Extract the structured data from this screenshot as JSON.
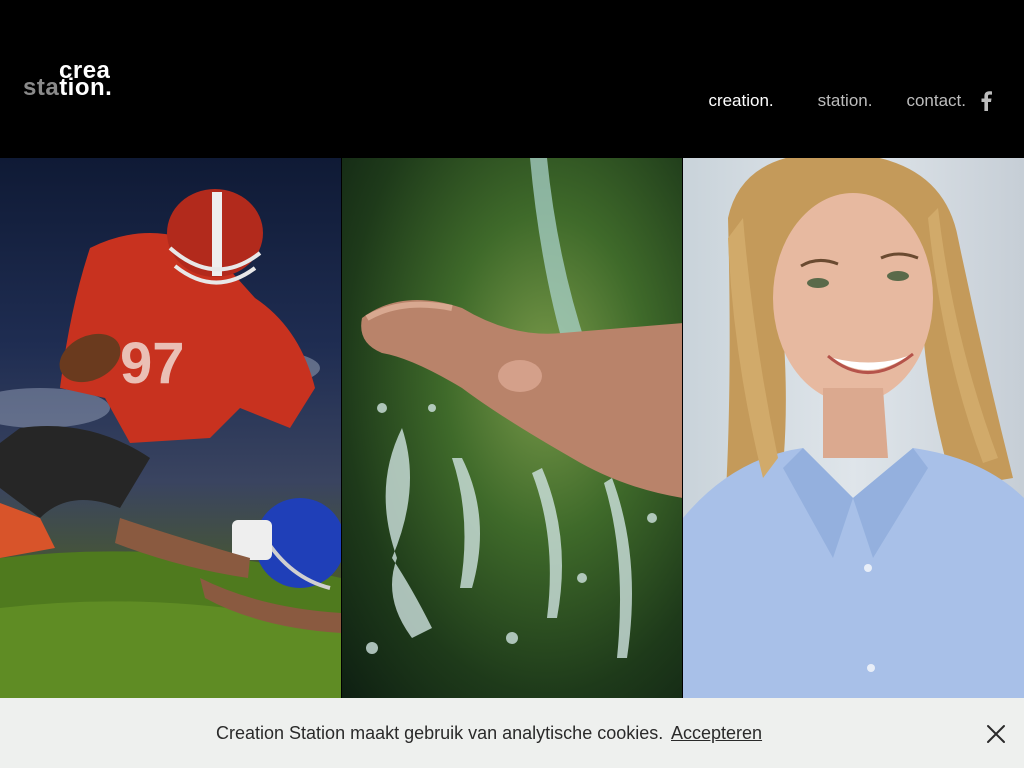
{
  "header": {
    "logo": {
      "line1": "crea",
      "line2_prefix": "sta",
      "line2_suffix": "tion."
    },
    "nav": [
      {
        "label": "creation.",
        "active": true
      },
      {
        "label": "station.",
        "active": false
      },
      {
        "label": "contact.",
        "active": false
      }
    ],
    "social_icon": "facebook-icon"
  },
  "hero": {
    "panels": [
      {
        "subject": "american-football-player"
      },
      {
        "subject": "hand-under-water-stream"
      },
      {
        "subject": "smiling-woman-blue-shirt"
      }
    ]
  },
  "cookie_bar": {
    "message": "Creation Station maakt gebruik van analytische cookies.",
    "accept_label": "Accepteren",
    "close_icon": "close-icon"
  },
  "colors": {
    "header_bg": "#000000",
    "cookie_bg": "#eef0ee",
    "nav_active": "#ffffff",
    "nav_inactive": "#bdbdbd"
  }
}
